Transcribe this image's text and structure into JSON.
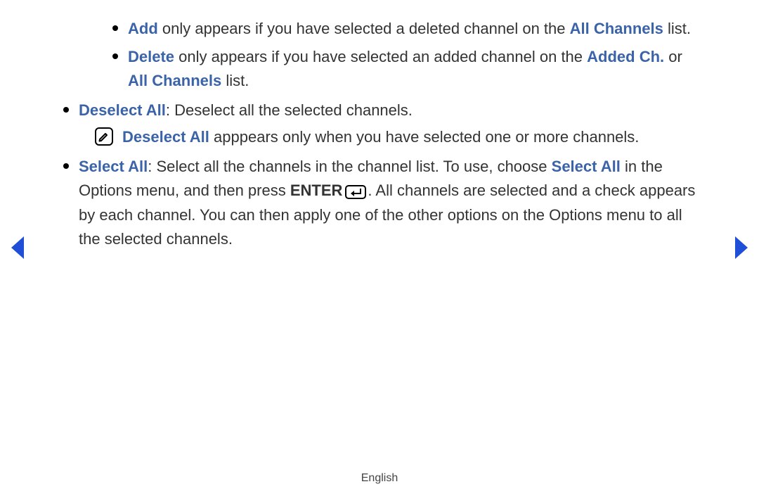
{
  "inner": {
    "add": {
      "t1": "Add",
      "t2": " only appears if you have selected a deleted channel on the ",
      "t3": "All Channels",
      "t4": " list."
    },
    "delete": {
      "t1": "Delete",
      "t2": " only appears if you have selected an added channel on the ",
      "t3": "Added Ch.",
      "t4": " or ",
      "t5": "All Channels",
      "t6": " list."
    }
  },
  "deselect": {
    "label": "Deselect All",
    "desc": ": Deselect all the selected channels."
  },
  "note": {
    "t1": "Deselect All",
    "t2": " apppears only when you have selected one or more channels."
  },
  "select": {
    "label": "Select All",
    "p1": ": Select all the channels in the channel list. To use, choose ",
    "p2": "Select All",
    "p3": " in the Options menu, and then press ",
    "enter": "ENTER",
    "p4": ". All channels are selected and a check appears by each channel. You can then apply one of the other options on the Options menu to all the selected channels."
  },
  "footer": {
    "language": "English"
  },
  "icons": {
    "note": "note-pencil-icon",
    "enter": "enter-key-icon",
    "prev": "nav-prev-icon",
    "next": "nav-next-icon"
  },
  "colors": {
    "link_color": "#3b63a8",
    "nav_arrow_color": "#1f4fd6"
  }
}
